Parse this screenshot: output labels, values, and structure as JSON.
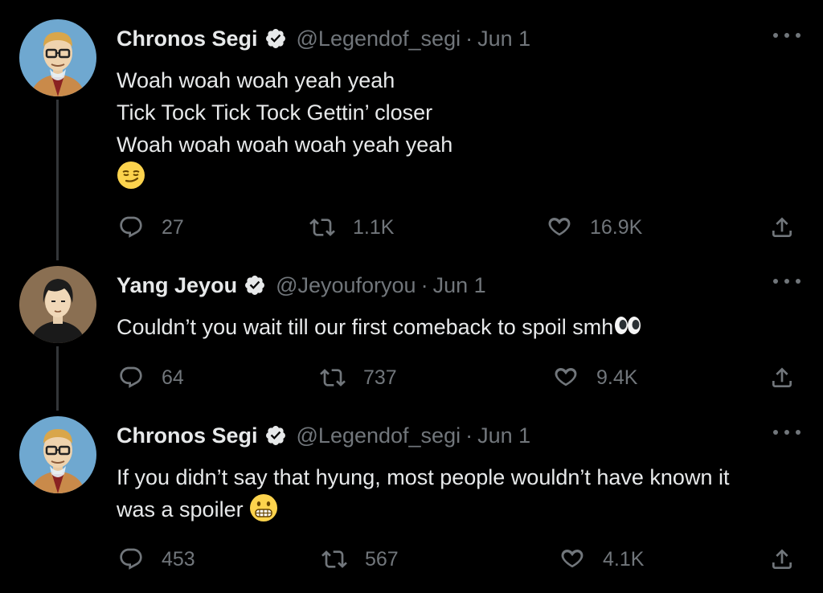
{
  "tweets": [
    {
      "name": "Chronos Segi",
      "handle": "@Legendof_segi",
      "separator": "·",
      "date": "Jun 1",
      "lines": [
        "Woah woah woah yeah yeah",
        "Tick Tock Tick Tock Gettin’ closer",
        "Woah woah woah woah yeah yeah"
      ],
      "emoji": "smirking-face",
      "replies": "27",
      "retweets": "1.1K",
      "likes": "16.9K",
      "avatar": "glasses-man-avatar"
    },
    {
      "name": "Yang Jeyou",
      "handle": "@Jeyouforyou",
      "separator": "·",
      "date": "Jun 1",
      "lines": [
        "Couldn’t you wait till our first comeback to spoil smh"
      ],
      "emoji": "eyes",
      "replies": "64",
      "retweets": "737",
      "likes": "9.4K",
      "avatar": "dark-hair-man-avatar"
    },
    {
      "name": "Chronos Segi",
      "handle": "@Legendof_segi",
      "separator": "·",
      "date": "Jun 1",
      "lines": [
        "If you didn’t say that hyung, most people wouldn’t have known it",
        "was a spoiler"
      ],
      "emoji": "grimacing-face",
      "replies": "453",
      "retweets": "567",
      "likes": "4.1K",
      "avatar": "glasses-man-avatar"
    }
  ],
  "colors": {
    "background": "#000000",
    "text": "#e7e9ea",
    "muted": "#71767b",
    "verified": "#e7e9ea",
    "thread_line": "#333639"
  }
}
